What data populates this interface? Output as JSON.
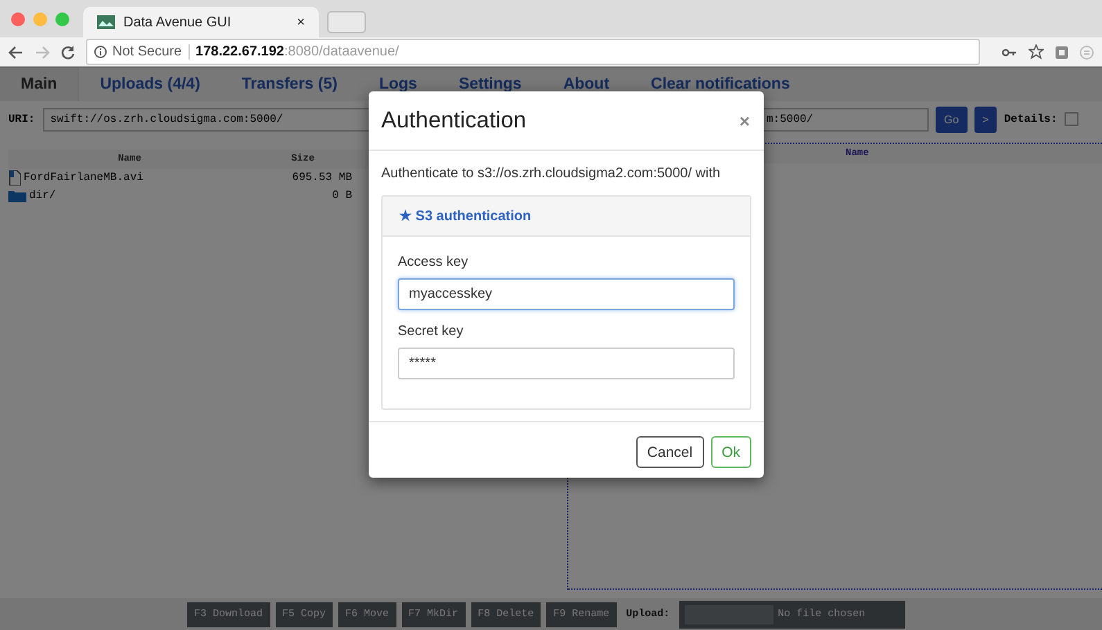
{
  "browser": {
    "tab_title": "Data Avenue GUI",
    "tab_close": "×",
    "security": "Not Secure",
    "url_host": "178.22.67.192",
    "url_rest": ":8080/dataavenue/"
  },
  "nav_tabs": [
    {
      "label": "Main",
      "selected": true
    },
    {
      "label": "Uploads (4/4)",
      "selected": false
    },
    {
      "label": "Transfers (5)",
      "selected": false
    },
    {
      "label": "Logs",
      "selected": false
    },
    {
      "label": "Settings",
      "selected": false
    },
    {
      "label": "About",
      "selected": false
    },
    {
      "label": "Clear notifications",
      "selected": false
    }
  ],
  "left_panel": {
    "uri_label": "URI:",
    "uri_value": "swift://os.zrh.cloudsigma.com:5000/",
    "columns": [
      "Name",
      "Size"
    ],
    "rows": [
      {
        "kind": "file",
        "name": "FordFairlaneMB.avi",
        "size": "695.53 MB"
      },
      {
        "kind": "folder",
        "name": "dir/",
        "size": "0 B"
      }
    ]
  },
  "right_panel": {
    "uri_value": "m:5000/",
    "go": "Go",
    "next": ">",
    "details_label": "Details:",
    "details_checked": false,
    "columns": [
      "Name"
    ]
  },
  "bottom_bar": {
    "buttons": [
      "F3 Download",
      "F5 Copy",
      "F6 Move",
      "F7 MkDir",
      "F8 Delete",
      "F9 Rename"
    ],
    "upload_label": "Upload:",
    "file_status": "No file chosen"
  },
  "modal": {
    "title": "Authentication",
    "close": "×",
    "prompt": "Authenticate to s3://os.zrh.cloudsigma2.com:5000/ with",
    "method": "★ S3 authentication",
    "fields": [
      {
        "label": "Access key",
        "value": "myaccesskey",
        "focused": true
      },
      {
        "label": "Secret key",
        "value": "*****",
        "focused": false
      }
    ],
    "buttons": [
      {
        "label": "Cancel",
        "kind": "default"
      },
      {
        "label": "Ok",
        "kind": "ok"
      }
    ]
  }
}
